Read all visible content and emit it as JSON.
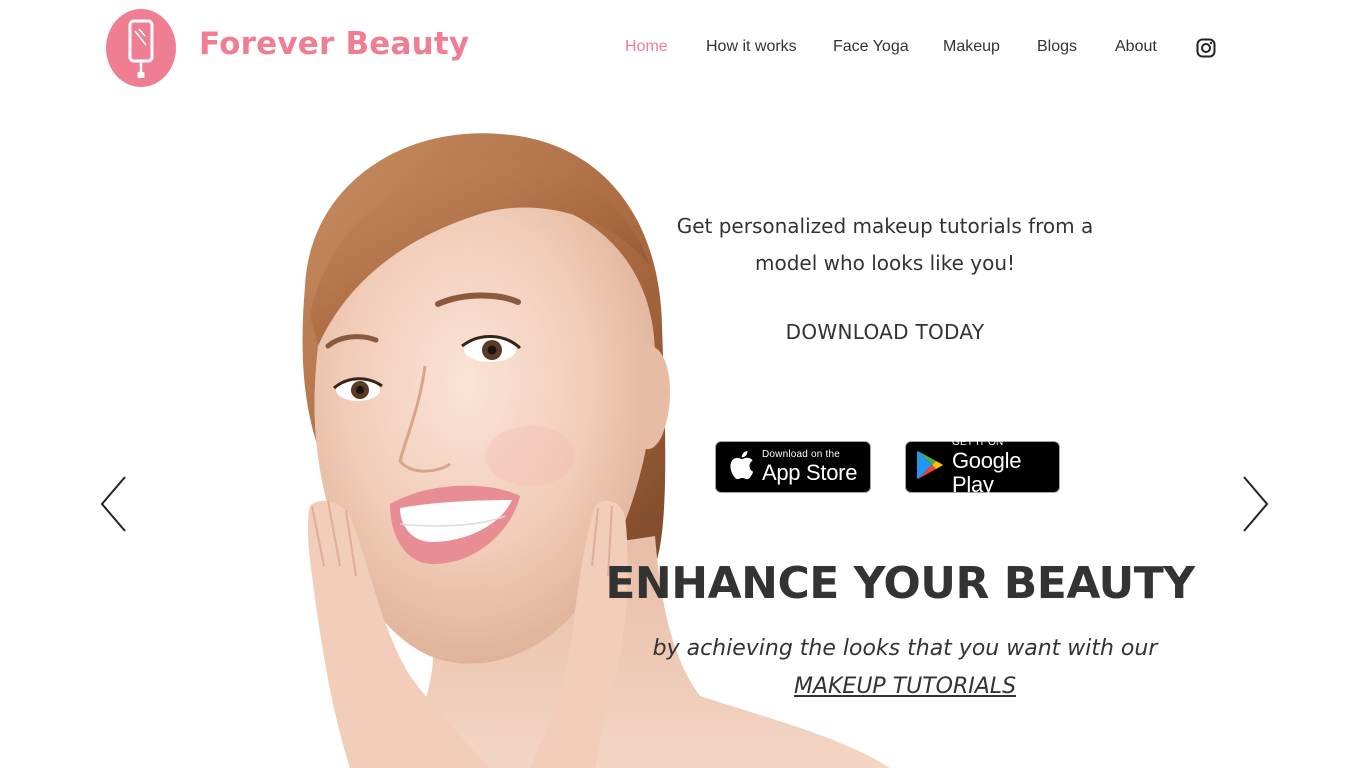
{
  "brand": {
    "name": "Forever Beauty",
    "color": "#f07e93"
  },
  "nav": {
    "items": [
      {
        "label": "Home",
        "active": true
      },
      {
        "label": "How it works",
        "active": false
      },
      {
        "label": "Face Yoga",
        "active": false
      },
      {
        "label": "Makeup",
        "active": false
      },
      {
        "label": "Blogs",
        "active": false
      },
      {
        "label": "About",
        "active": false
      }
    ],
    "social_icon": "instagram-icon",
    "active_color": "#f07e93"
  },
  "hero": {
    "tagline_line1": "Get personalized makeup tutorials from a",
    "tagline_line2": "model who looks like you!",
    "download_label": "DOWNLOAD TODAY",
    "app_store": {
      "small": "Download on the",
      "big": "App Store",
      "icon": "apple-icon"
    },
    "google_play": {
      "small": "GET IT ON",
      "big": "Google Play",
      "icon": "google-play-icon"
    },
    "headline": "ENHANCE YOUR BEAUTY",
    "subline": "by achieving the looks that you want with our",
    "subline_link": "MAKEUP TUTORIALS",
    "prev_icon": "chevron-left-icon",
    "next_icon": "chevron-right-icon"
  }
}
